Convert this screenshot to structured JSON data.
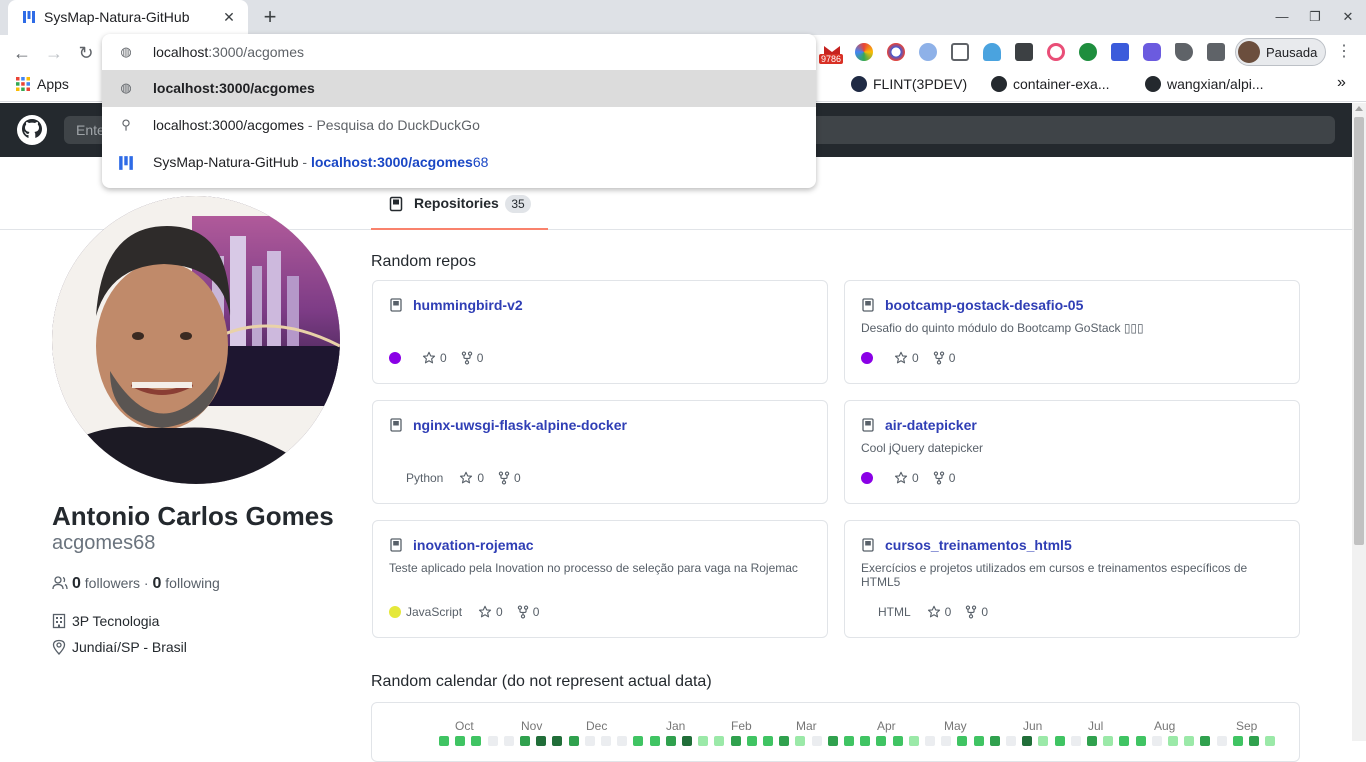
{
  "browser": {
    "tab_title": "SysMap-Natura-GitHub",
    "new_tab": "+",
    "close": "✕",
    "profile_label": "Pausada",
    "gmail_badge": "9786",
    "omnibox": {
      "input_host": "localhost",
      "input_path": ":3000/acgomes",
      "suggestions": [
        {
          "text": "localhost:3000/acgomes"
        },
        {
          "text": "localhost:3000/acgomes",
          "suffix": " - Pesquisa do DuckDuckGo"
        },
        {
          "text": "SysMap-Natura-GitHub",
          "sep": " - ",
          "url": "localhost:3000/acgomes",
          "url_rest": "68"
        }
      ]
    },
    "bookmarks": [
      {
        "label": "Apps"
      },
      {
        "label": "FLINT(3PDEV)"
      },
      {
        "label": "container-exa..."
      },
      {
        "label": "wangxian/alpi..."
      }
    ],
    "bookmarks_more": "»"
  },
  "github": {
    "search_placeholder": "Ente"
  },
  "profile": {
    "full_name": "Antonio Carlos Gomes",
    "username": "acgomes68",
    "followers": "0",
    "followers_label": "followers",
    "following": "0",
    "following_label": "following",
    "company": "3P Tecnologia",
    "location": "Jundiaí/SP - Brasil"
  },
  "tabs": {
    "repositories_label": "Repositories",
    "repositories_count": "35"
  },
  "random_repos_heading": "Random repos",
  "repos": [
    {
      "name": "hummingbird-v2",
      "description": "",
      "language": "",
      "lang_color": "#8a00e6",
      "stars": "0",
      "forks": "0"
    },
    {
      "name": "bootcamp-gostack-desafio-05",
      "description": "Desafio do quinto módulo do Bootcamp GoStack ▯▯▯",
      "language": "",
      "lang_color": "#8a00e6",
      "stars": "0",
      "forks": "0"
    },
    {
      "name": "nginx-uwsgi-flask-alpine-docker",
      "description": "",
      "language": "Python",
      "lang_color": "",
      "stars": "0",
      "forks": "0"
    },
    {
      "name": "air-datepicker",
      "description": "Cool jQuery datepicker",
      "language": "",
      "lang_color": "#8a00e6",
      "stars": "0",
      "forks": "0"
    },
    {
      "name": "inovation-rojemac",
      "description": "Teste aplicado pela Inovation no processo de seleção para vaga na Rojemac",
      "language": "JavaScript",
      "lang_color": "#e5e83a",
      "stars": "0",
      "forks": "0"
    },
    {
      "name": "cursos_treinamentos_html5",
      "description": "Exercícios e projetos utilizados em cursos e treinamentos específicos de HTML5",
      "language": "HTML",
      "lang_color": "",
      "stars": "0",
      "forks": "0"
    }
  ],
  "calendar": {
    "heading": "Random calendar (do not represent actual data)",
    "months": [
      "Oct",
      "Nov",
      "Dec",
      "Jan",
      "Feb",
      "Mar",
      "Apr",
      "May",
      "Jun",
      "Jul",
      "Aug",
      "Sep"
    ]
  },
  "colors": {
    "accent_tab_underline": "#f9826c",
    "github_header": "#24292e",
    "repo_link": "#2f3eb5"
  }
}
